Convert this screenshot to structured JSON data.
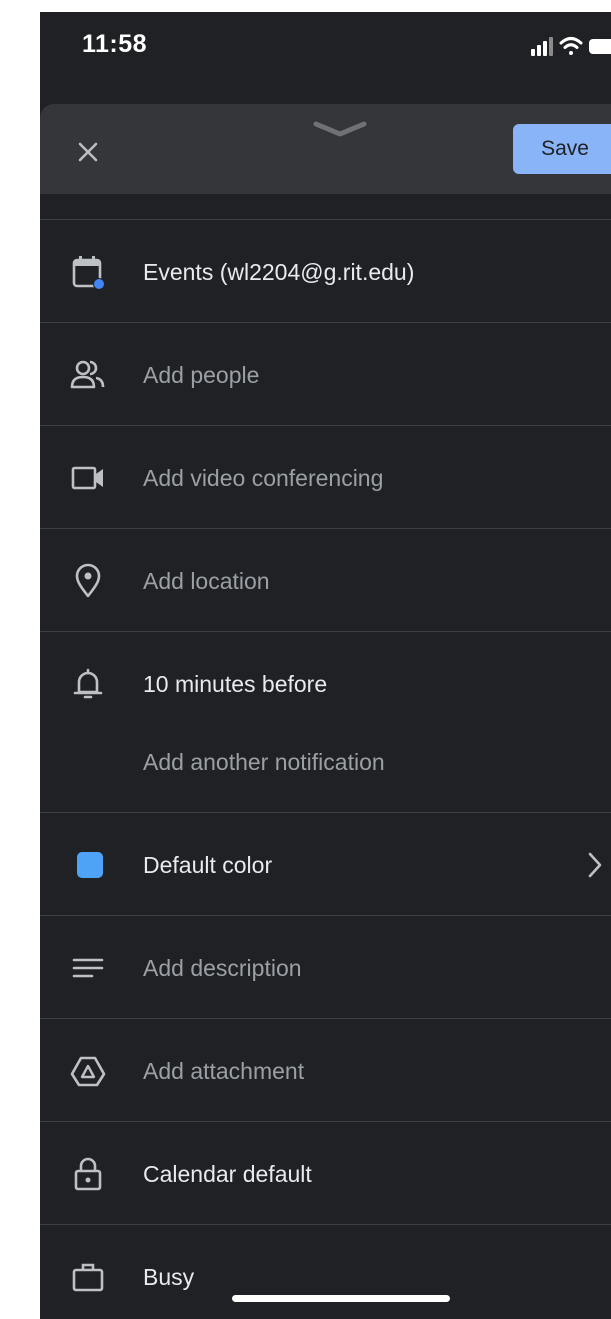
{
  "status_bar": {
    "time": "11:58",
    "icons": [
      "signal-icon",
      "wifi-icon",
      "battery-icon"
    ]
  },
  "header": {
    "close_icon": "close-icon",
    "handle_icon": "chevron-down-icon",
    "save_label": "Save"
  },
  "rows": {
    "calendar": {
      "icon": "calendar-icon",
      "label": "Events (wl2204@g.rit.edu)"
    },
    "people": {
      "icon": "people-icon",
      "label": "Add people"
    },
    "video": {
      "icon": "video-icon",
      "label": "Add video conferencing"
    },
    "location": {
      "icon": "location-pin-icon",
      "label": "Add location"
    },
    "notification": {
      "icon": "bell-icon",
      "label": "10 minutes before",
      "add_label": "Add another notification"
    },
    "color": {
      "icon": "color-swatch",
      "label": "Default color",
      "chevron": "chevron-right-icon"
    },
    "description": {
      "icon": "notes-icon",
      "label": "Add description"
    },
    "attachment": {
      "icon": "drive-icon",
      "label": "Add attachment"
    },
    "visibility": {
      "icon": "lock-icon",
      "label": "Calendar default"
    },
    "availability": {
      "icon": "briefcase-icon",
      "label": "Busy"
    }
  },
  "colors": {
    "background": "#202124",
    "header": "#35363a",
    "accent": "#8ab4f8",
    "calendar_dot": "#4285f4",
    "swatch": "#4fa3f7",
    "divider": "#3c4043",
    "primary_text": "#e8eaed",
    "secondary_text": "#9aa0a6"
  }
}
